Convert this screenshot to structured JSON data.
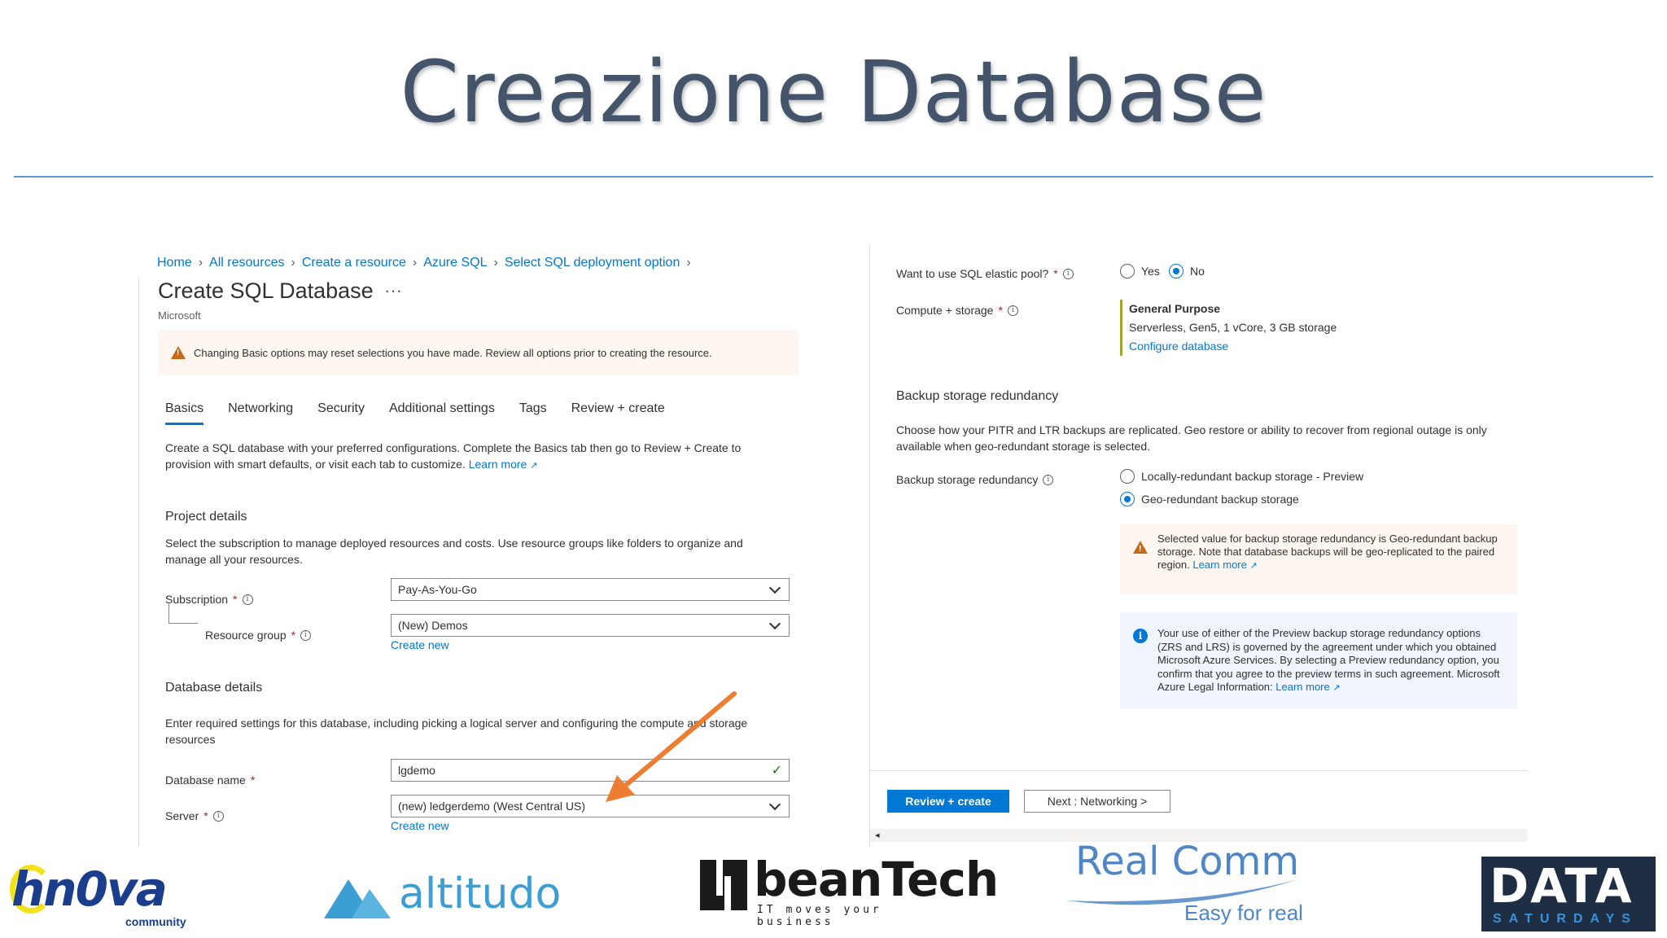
{
  "slide": {
    "title": "Creazione Database"
  },
  "breadcrumb": [
    "Home",
    "All resources",
    "Create a resource",
    "Azure SQL",
    "Select SQL deployment option"
  ],
  "header": {
    "title": "Create SQL Database",
    "more": "···",
    "publisher": "Microsoft"
  },
  "banner": {
    "text": "Changing Basic options may reset selections you have made. Review all options prior to creating the resource."
  },
  "tabs": [
    "Basics",
    "Networking",
    "Security",
    "Additional settings",
    "Tags",
    "Review + create"
  ],
  "intro": {
    "text": "Create a SQL database with your preferred configurations. Complete the Basics tab then go to Review + Create to provision with smart defaults, or visit each tab to customize.",
    "link": "Learn more"
  },
  "project": {
    "heading": "Project details",
    "text": "Select the subscription to manage deployed resources and costs. Use resource groups like folders to organize and manage all your resources.",
    "subscription_label": "Subscription",
    "subscription_value": "Pay-As-You-Go",
    "rg_label": "Resource group",
    "rg_value": "(New) Demos",
    "create_new": "Create new"
  },
  "database": {
    "heading": "Database details",
    "text": "Enter required settings for this database, including picking a logical server and configuring the compute and storage resources",
    "name_label": "Database name",
    "name_value": "lgdemo",
    "server_label": "Server",
    "server_value": "(new) ledgerdemo (West Central US)",
    "create_new": "Create new"
  },
  "right": {
    "elastic_label": "Want to use SQL elastic pool?",
    "elastic_yes": "Yes",
    "elastic_no": "No",
    "compute_label": "Compute + storage",
    "compute_tier": "General Purpose",
    "compute_detail": "Serverless, Gen5, 1 vCore, 3 GB storage",
    "compute_link": "Configure database",
    "backup_heading": "Backup storage redundancy",
    "backup_text": "Choose how your PITR and LTR backups are replicated. Geo restore or ability to recover from regional outage is only available when geo-redundant storage is selected.",
    "backup_label": "Backup storage redundancy",
    "backup_opt1": "Locally-redundant backup storage - Preview",
    "backup_opt2": "Geo-redundant backup storage",
    "warn_text": "Selected value for backup storage redundancy is Geo-redundant backup storage. Note that database backups will be geo-replicated to the paired region.",
    "warn_link": "Learn more",
    "info_text": "Your use of either of the Preview backup storage redundancy options (ZRS and LRS) is governed by the agreement under which you obtained Microsoft Azure Services. By selecting a Preview redundancy option, you confirm that you agree to the preview terms in such agreement. Microsoft Azure Legal Information:",
    "info_link": "Learn more"
  },
  "footer": {
    "primary": "Review + create",
    "secondary": "Next : Networking >"
  },
  "logos": {
    "innova": "hn0va",
    "innova_sub": "community",
    "altitudo": "altitudo",
    "beantech": "beanTech",
    "beantech_sub": "IT moves your business",
    "realcomm": "Real Comm",
    "realcomm_sub": "Easy for real",
    "data": "DATA",
    "data_sub": "SATURDAYS"
  },
  "colors": {
    "accent": "#0078d4",
    "title": "#44546a",
    "warning": "#c76a16",
    "arrow": "#ed7d31"
  }
}
